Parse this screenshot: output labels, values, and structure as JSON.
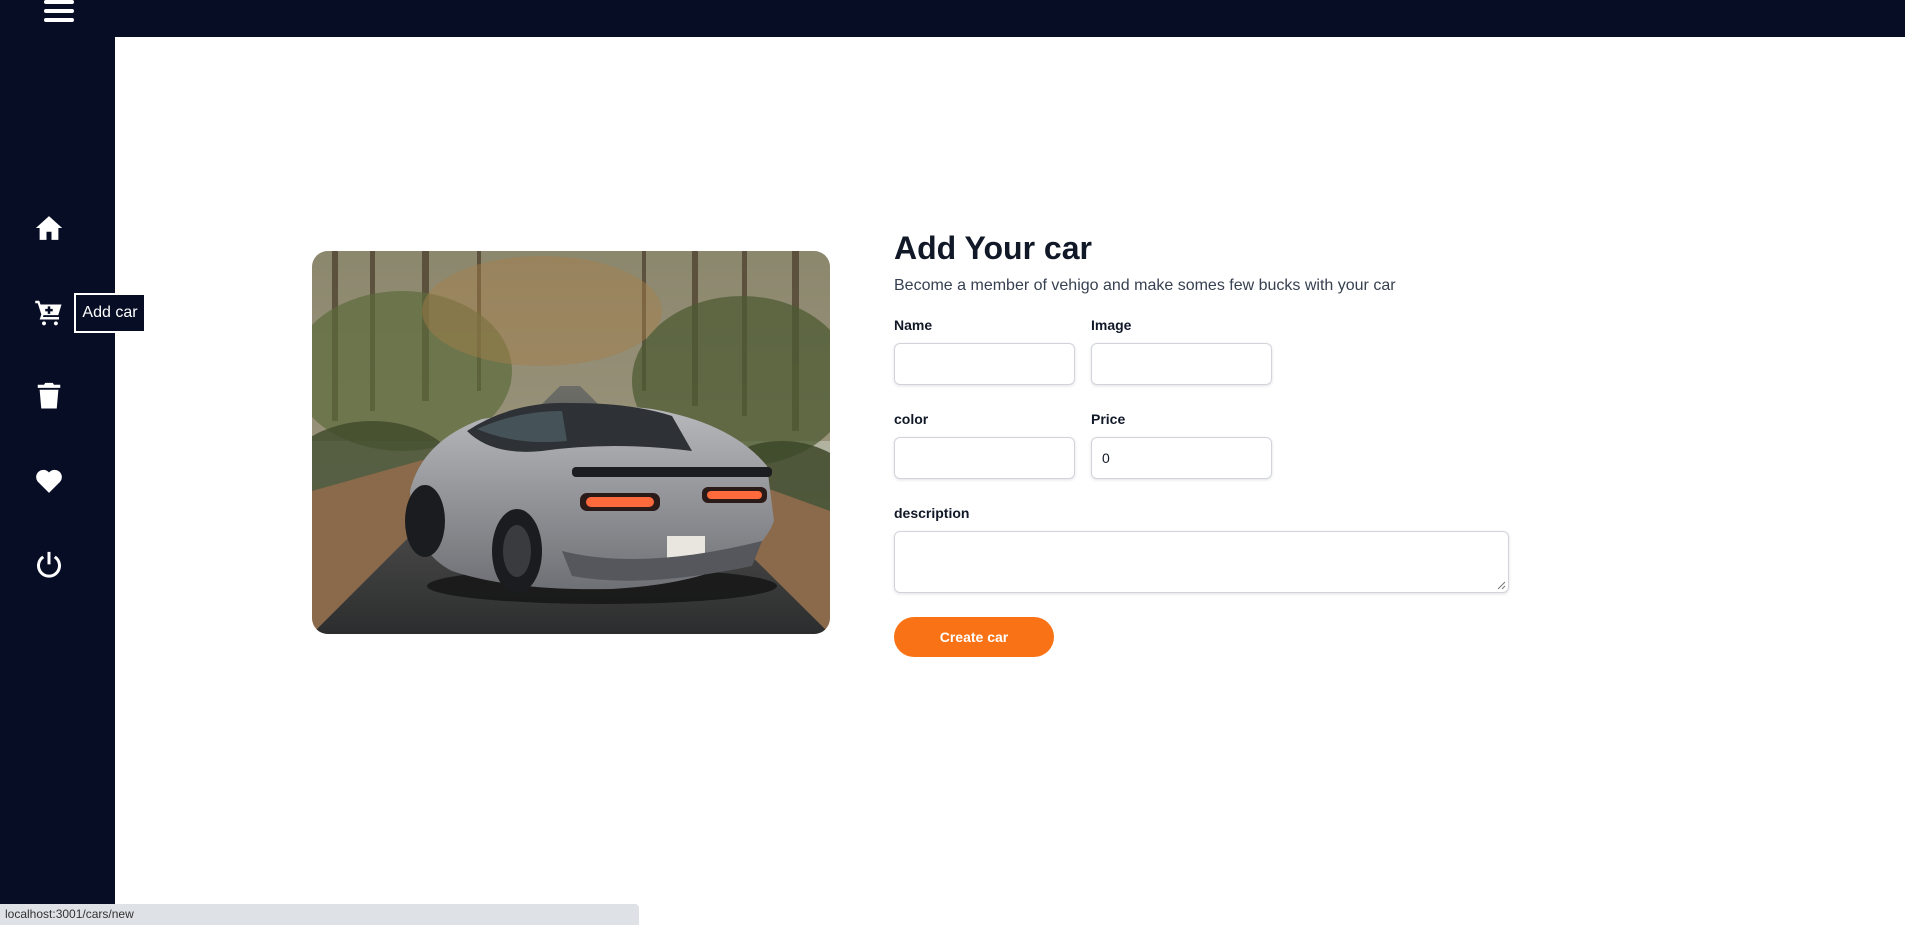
{
  "sidebar": {
    "items": [
      {
        "name": "home",
        "icon": "home-icon"
      },
      {
        "name": "add-car",
        "icon": "cart-plus-icon"
      },
      {
        "name": "delete",
        "icon": "trash-icon"
      },
      {
        "name": "favorites",
        "icon": "heart-icon"
      },
      {
        "name": "logout",
        "icon": "power-icon"
      }
    ],
    "tooltip": "Add car"
  },
  "form": {
    "title": "Add Your car",
    "subtitle": "Become a member of vehigo and make somes few bucks with your car",
    "fields": {
      "name": {
        "label": "Name",
        "value": ""
      },
      "image": {
        "label": "Image",
        "value": ""
      },
      "color": {
        "label": "color",
        "value": ""
      },
      "price": {
        "label": "Price",
        "value": "0"
      },
      "description": {
        "label": "description",
        "value": ""
      }
    },
    "submit_label": "Create car"
  },
  "status_url": "localhost:3001/cars/new",
  "colors": {
    "sidebar_bg": "#070d24",
    "accent": "#f97316"
  }
}
